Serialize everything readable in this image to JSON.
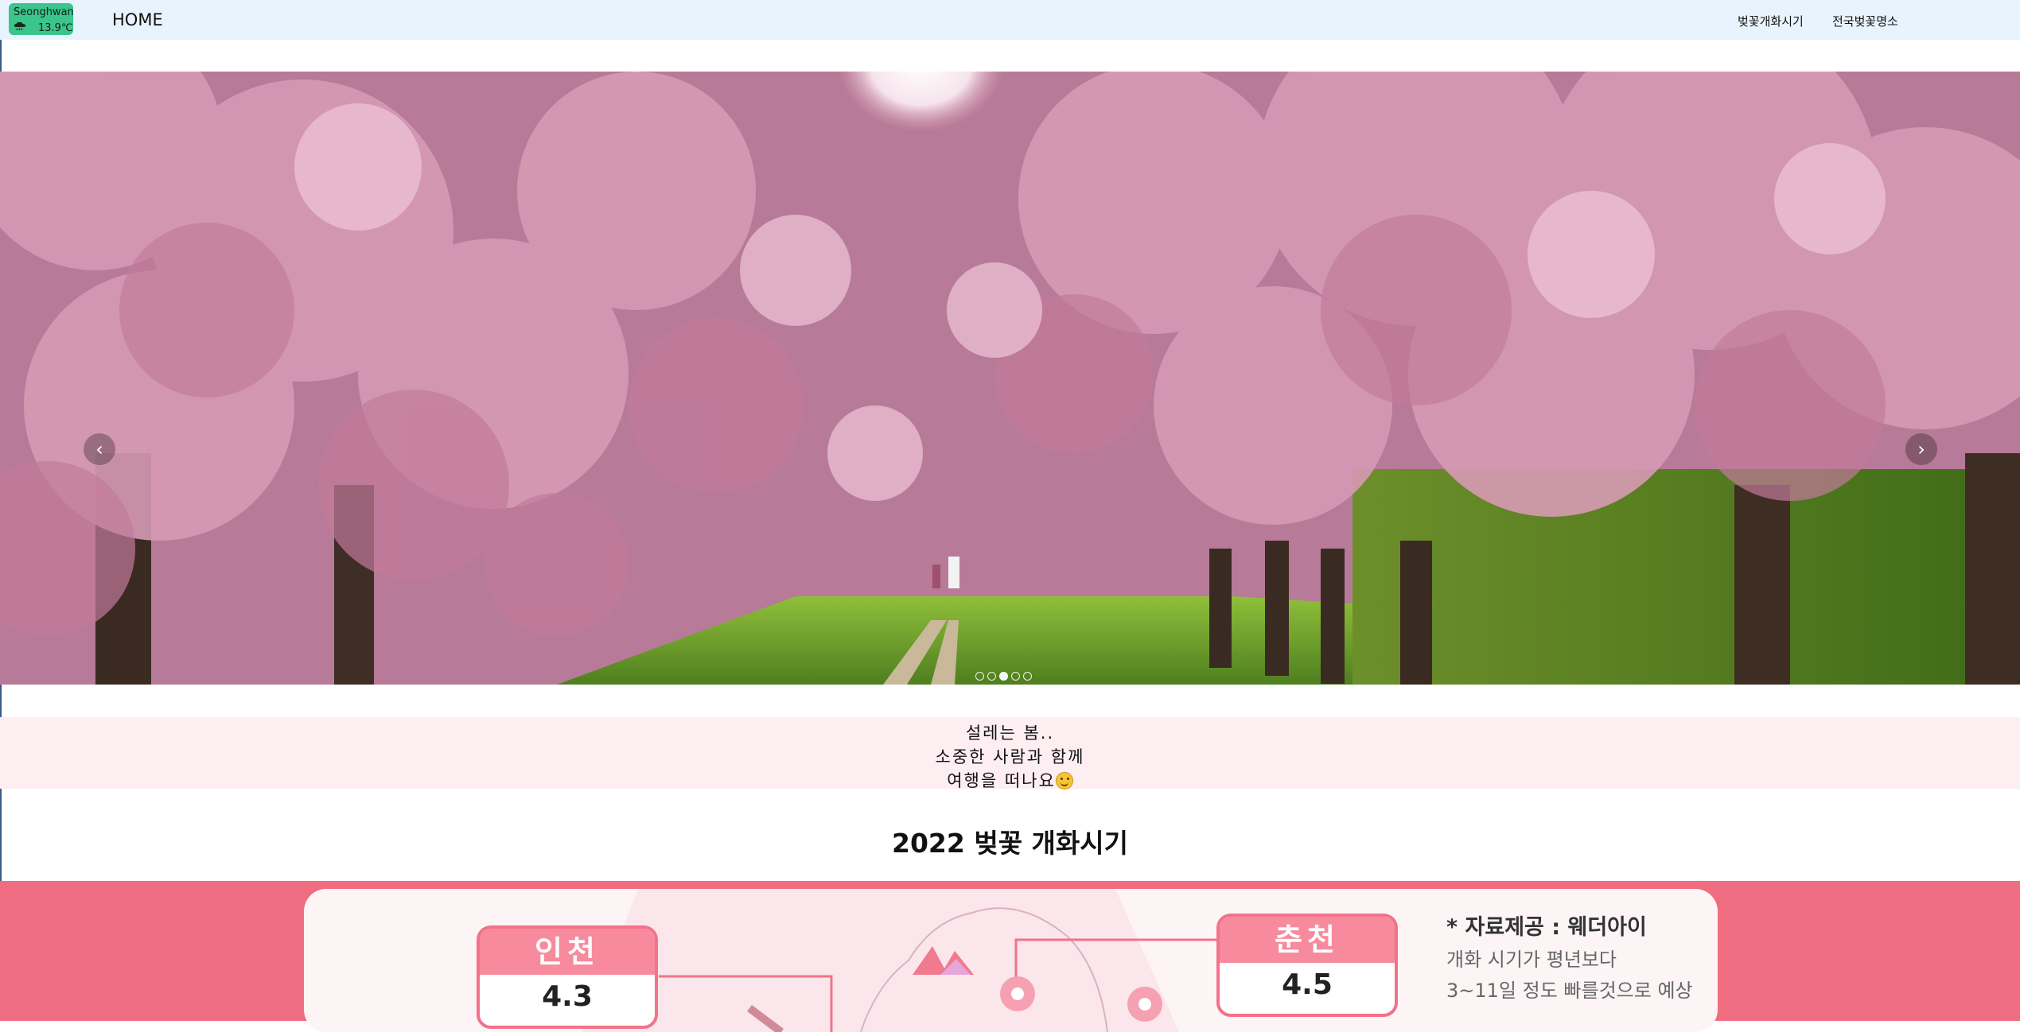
{
  "navbar": {
    "weather": {
      "city": "Seonghwan",
      "temperature": "13.9℃",
      "icon": "cloud-rain-icon"
    },
    "brand": "HOME",
    "links": [
      "벚꽃개화시기",
      "전국벚꽃명소"
    ]
  },
  "carousel": {
    "prev_icon": "chevron-left-icon",
    "next_icon": "chevron-right-icon",
    "slide_count": 5,
    "active_index": 3
  },
  "message": {
    "lines": [
      "설레는 봄..",
      "소중한 사람과 함께",
      "여행을 떠나요"
    ],
    "emoji": "smiling-face-icon"
  },
  "bloom_section": {
    "title": "2022 벚꽃 개화시기",
    "cities": [
      {
        "name": "인천",
        "date": "4.3"
      },
      {
        "name": "춘천",
        "date": "4.5"
      }
    ],
    "source": {
      "title": "* 자료제공 : 웨더아이",
      "lines": [
        "개화 시기가 평년보다",
        "3~11일 정도 빠를것으로 예상"
      ]
    }
  },
  "colors": {
    "navbar_bg": "#e8f4fd",
    "weather_badge": "#3bc48c",
    "message_bg": "#fdeef2",
    "bloom_band": "#f06c80",
    "city_header": "#f78a9c"
  }
}
